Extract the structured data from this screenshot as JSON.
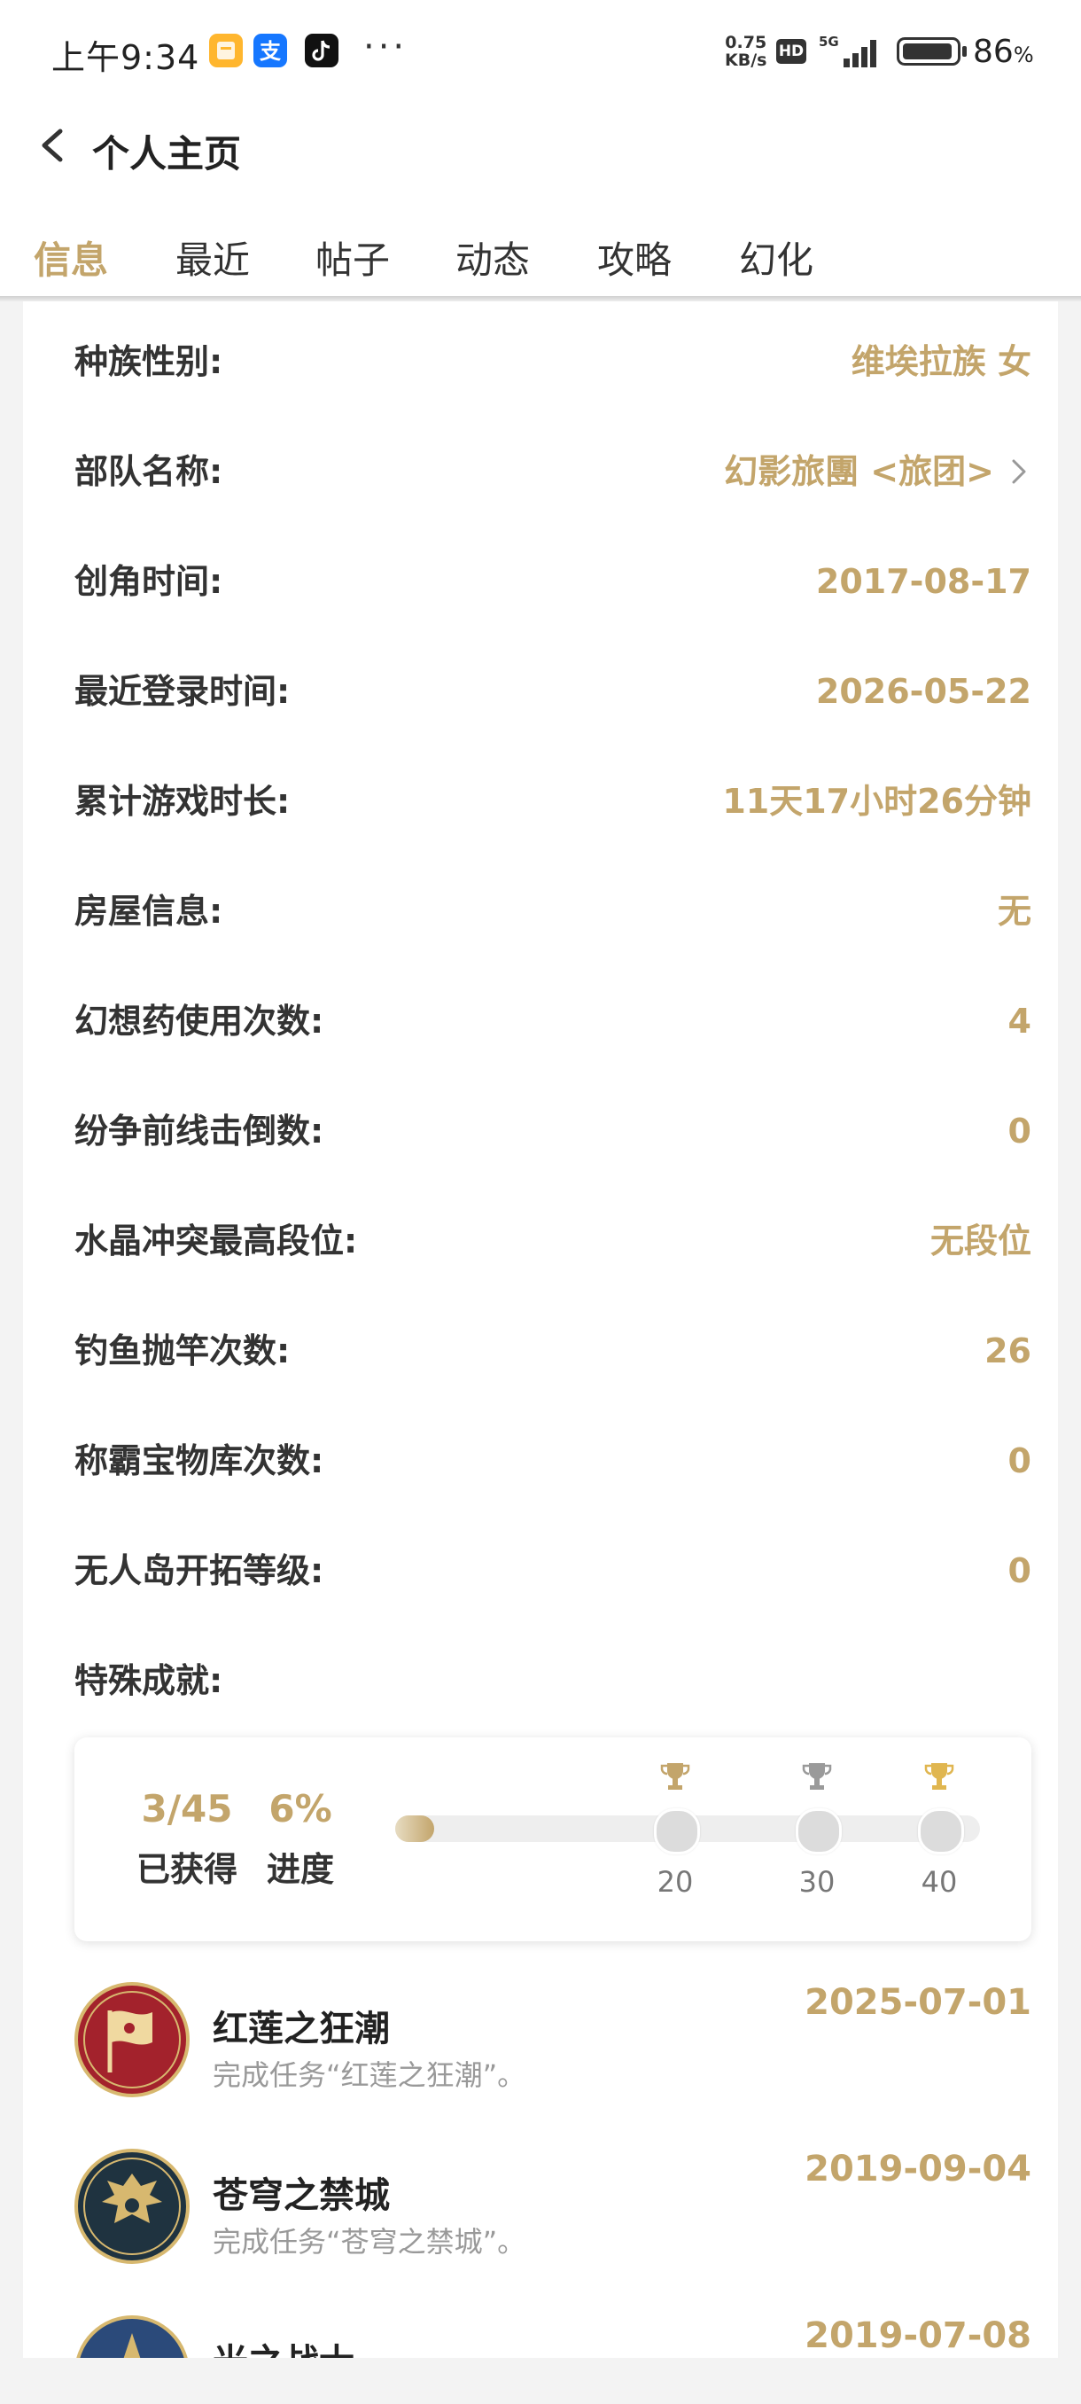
{
  "status_bar": {
    "time": "上午9:34",
    "more": "···",
    "net_speed_value": "0.75",
    "net_speed_unit": "KB/s",
    "hd": "HD",
    "network": "5G",
    "battery": "86",
    "battery_unit": "%",
    "app_icons": [
      "notes-app-icon",
      "alipay-app-icon",
      "tiktok-app-icon"
    ]
  },
  "header": {
    "title": "个人主页"
  },
  "tabs": [
    {
      "label": "信息",
      "active": true
    },
    {
      "label": "最近"
    },
    {
      "label": "帖子"
    },
    {
      "label": "动态"
    },
    {
      "label": "攻略"
    },
    {
      "label": "幻化"
    }
  ],
  "info_rows": [
    {
      "label": "种族性别:",
      "value": "维埃拉族 女"
    },
    {
      "label": "部队名称:",
      "value": "幻影旅團 <旅团>",
      "link": true
    },
    {
      "label": "创角时间:",
      "value": "2017-08-17"
    },
    {
      "label": "最近登录时间:",
      "value": "2026-05-22"
    },
    {
      "label": "累计游戏时长:",
      "value": "11天17小时26分钟"
    },
    {
      "label": "房屋信息:",
      "value": "无"
    },
    {
      "label": "幻想药使用次数:",
      "value": "4"
    },
    {
      "label": "纷争前线击倒数:",
      "value": "0"
    },
    {
      "label": "水晶冲突最高段位:",
      "value": "无段位"
    },
    {
      "label": "钓鱼抛竿次数:",
      "value": "26"
    },
    {
      "label": "称霸宝物库次数:",
      "value": "0"
    },
    {
      "label": "无人岛开拓等级:",
      "value": "0"
    },
    {
      "label": "特殊成就:",
      "value": ""
    }
  ],
  "achievements_summary": {
    "count": "3/45",
    "count_label": "已获得",
    "percent": "6%",
    "percent_label": "进度",
    "progress_fraction": 0.06,
    "milestones": [
      {
        "label": "20",
        "trophy_color": "#c3a56b"
      },
      {
        "label": "30",
        "trophy_color": "#9a9a9a"
      },
      {
        "label": "40",
        "trophy_color": "#e0b650"
      }
    ]
  },
  "achievements": [
    {
      "name": "红莲之狂潮",
      "desc": "完成任务“红莲之狂潮”。",
      "date": "2025-07-01",
      "icon": "red-banner-icon",
      "icon_color": "#a3222c"
    },
    {
      "name": "苍穹之禁城",
      "desc": "完成任务“苍穹之禁城”。",
      "date": "2019-09-04",
      "icon": "dragon-emblem-icon",
      "icon_color": "#1f3340"
    },
    {
      "name": "光之战士",
      "desc": "",
      "date": "2019-07-08",
      "icon": "star-emblem-icon",
      "icon_color": "#2b4a7a"
    }
  ],
  "colors": {
    "accent": "#c3a56b",
    "text": "#333333",
    "muted": "#999999"
  }
}
